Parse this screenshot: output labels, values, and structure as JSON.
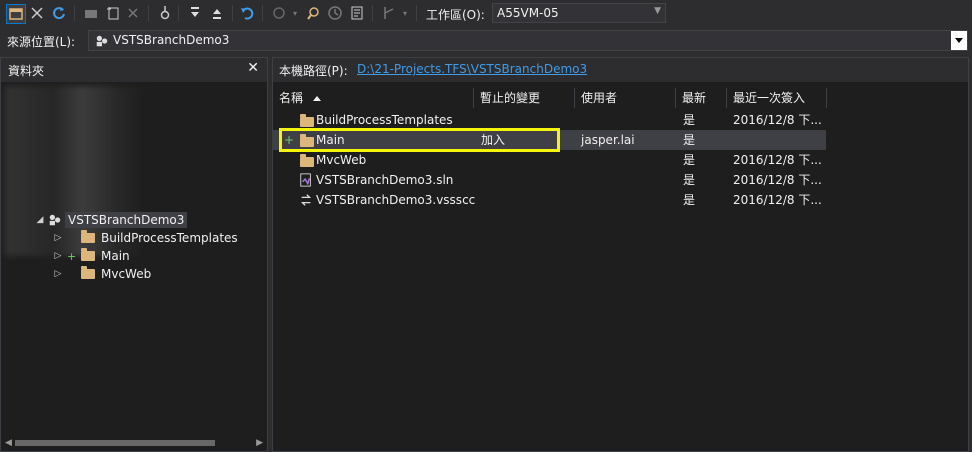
{
  "toolbar": {
    "buttons": [
      "new-workspace-icon",
      "disconnect-icon",
      "refresh-icon",
      "new-folder-icon",
      "add-item-icon",
      "delete-icon",
      "checkin-icon",
      "get-latest-icon",
      "checkout-icon",
      "undo-icon",
      "compare-icon",
      "find-icon",
      "history-icon",
      "properties-icon",
      "branch-icon"
    ],
    "workspace_label": "工作區(O):",
    "workspace_value": "A55VM-05"
  },
  "source": {
    "label": "來源位置(L):",
    "value": "VSTSBranchDemo3"
  },
  "folders_panel": {
    "title": "資料夾",
    "close": "✕",
    "tree": {
      "root": "VSTSBranchDemo3",
      "children": [
        {
          "label": "BuildProcessTemplates",
          "pending": ""
        },
        {
          "label": "Main",
          "pending": "+"
        },
        {
          "label": "MvcWeb",
          "pending": ""
        }
      ]
    }
  },
  "details": {
    "path_label": "本機路徑(P):",
    "path_value": "D:\\21-Projects.TFS\\VSTSBranchDemo3",
    "columns": [
      "名稱",
      "暫止的變更",
      "使用者",
      "最新",
      "最近一次簽入"
    ],
    "rows": [
      {
        "name": "BuildProcessTemplates",
        "pending": "",
        "user": "",
        "latest": "是",
        "checkin": "2016/12/8 下...",
        "icon": "folder",
        "prefix": ""
      },
      {
        "name": "Main",
        "pending": "加入",
        "user": "jasper.lai",
        "latest": "是",
        "checkin": "",
        "icon": "folder",
        "prefix": "+"
      },
      {
        "name": "MvcWeb",
        "pending": "",
        "user": "",
        "latest": "是",
        "checkin": "2016/12/8 下...",
        "icon": "folder",
        "prefix": ""
      },
      {
        "name": "VSTSBranchDemo3.sln",
        "pending": "",
        "user": "",
        "latest": "是",
        "checkin": "2016/12/8 下...",
        "icon": "sln",
        "prefix": ""
      },
      {
        "name": "VSTSBranchDemo3.vssscc",
        "pending": "",
        "user": "",
        "latest": "是",
        "checkin": "2016/12/8 下...",
        "icon": "vssscc",
        "prefix": ""
      }
    ]
  },
  "colors": {
    "background": "#2d2d30",
    "panel": "#1e1e1e",
    "link": "#3e9ce8",
    "highlight_box": "#f5f50a",
    "folder": "#dcb67a"
  }
}
